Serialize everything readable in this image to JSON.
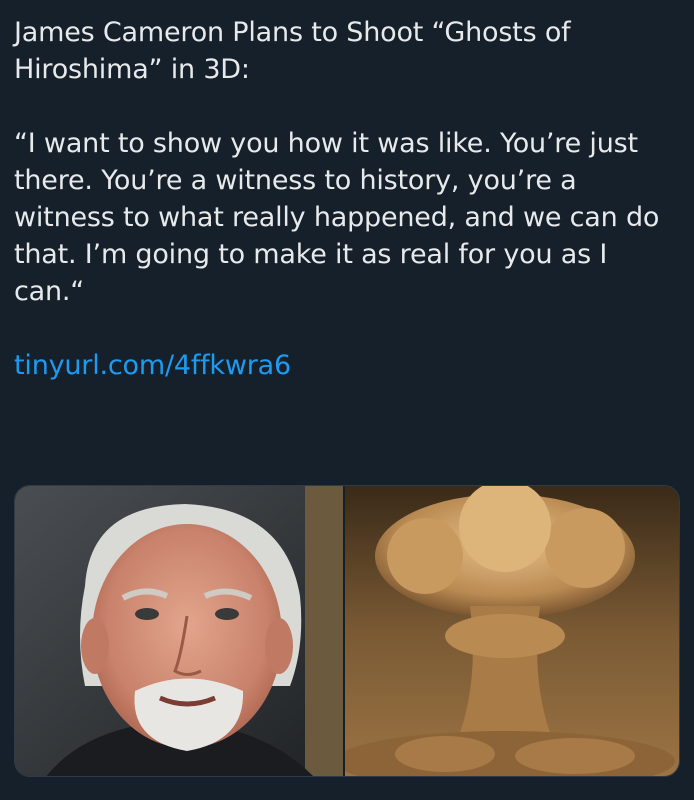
{
  "tweet": {
    "headline": "James Cameron Plans to Shoot “Ghosts of Hiroshima” in 3D:",
    "quote": "“I want to show you how it was like. You’re just there. You’re a witness to history, you’re a witness to what really happened, and we can do that. I’m going to make it as real for you as I can.“",
    "link": "tinyurl.com/4ffkwra6"
  },
  "media": {
    "left_image": "portrait-of-man-with-white-hair-and-goatee",
    "right_image": "mushroom-cloud-photo"
  },
  "colors": {
    "background": "#15202b",
    "text": "#e7e9ea",
    "link": "#1d9bf0"
  }
}
